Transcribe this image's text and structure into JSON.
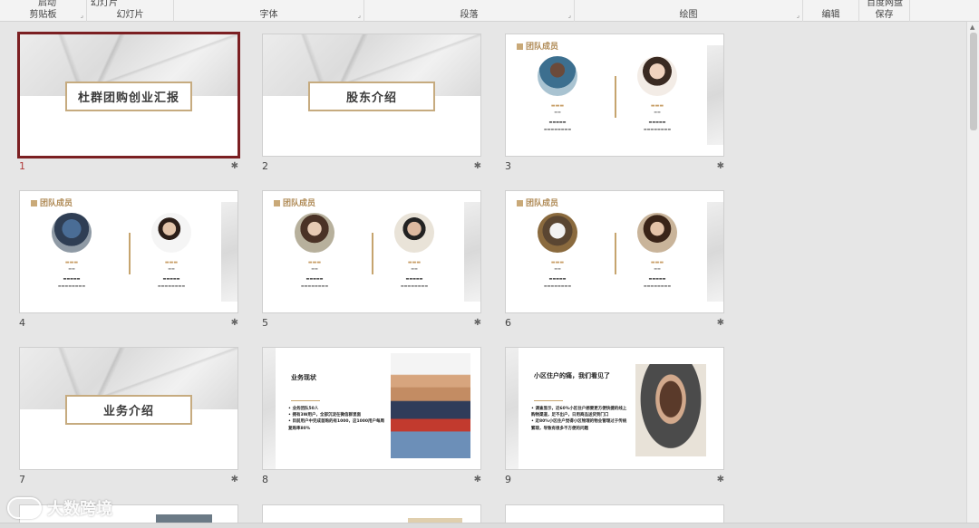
{
  "ribbon": {
    "groups": [
      {
        "label": "剪贴板"
      },
      {
        "label": "幻灯片"
      },
      {
        "label": "字体"
      },
      {
        "label": "段落"
      },
      {
        "label": "绘图"
      },
      {
        "label": "编辑"
      },
      {
        "label": "保存"
      }
    ],
    "cut_texts": [
      "启动",
      "幻灯片",
      "百度网盘"
    ]
  },
  "slides": [
    {
      "num": "1",
      "title": "杜群团购创业汇报"
    },
    {
      "num": "2",
      "title": "股东介绍"
    },
    {
      "num": "3",
      "section": "团队成员"
    },
    {
      "num": "4",
      "section": "团队成员"
    },
    {
      "num": "5",
      "section": "团队成员"
    },
    {
      "num": "6",
      "section": "团队成员"
    },
    {
      "num": "7",
      "title": "业务介绍"
    },
    {
      "num": "8",
      "title": "业务现状",
      "bullets": [
        "业务团队50人",
        "拥有3W用户，全部沉淀在微信群里面",
        "目前用户中完成首购的有1000，这1000用户每周复购率80%"
      ]
    },
    {
      "num": "9",
      "title": "小区住户的痛，我们看见了",
      "bullets": [
        "调查显示，近60%小区住户想要更方便快捷的线上购物渠道，足不出户，日用商品送货到门口",
        "近80%小区住户觉得小区物理的物业管理过于传统繁琐，导致有很多不方便的问题"
      ]
    }
  ],
  "watermark": {
    "text": "大数跨境"
  },
  "colors": {
    "selection": "#7b1f22",
    "gold": "#c6ab7f"
  }
}
